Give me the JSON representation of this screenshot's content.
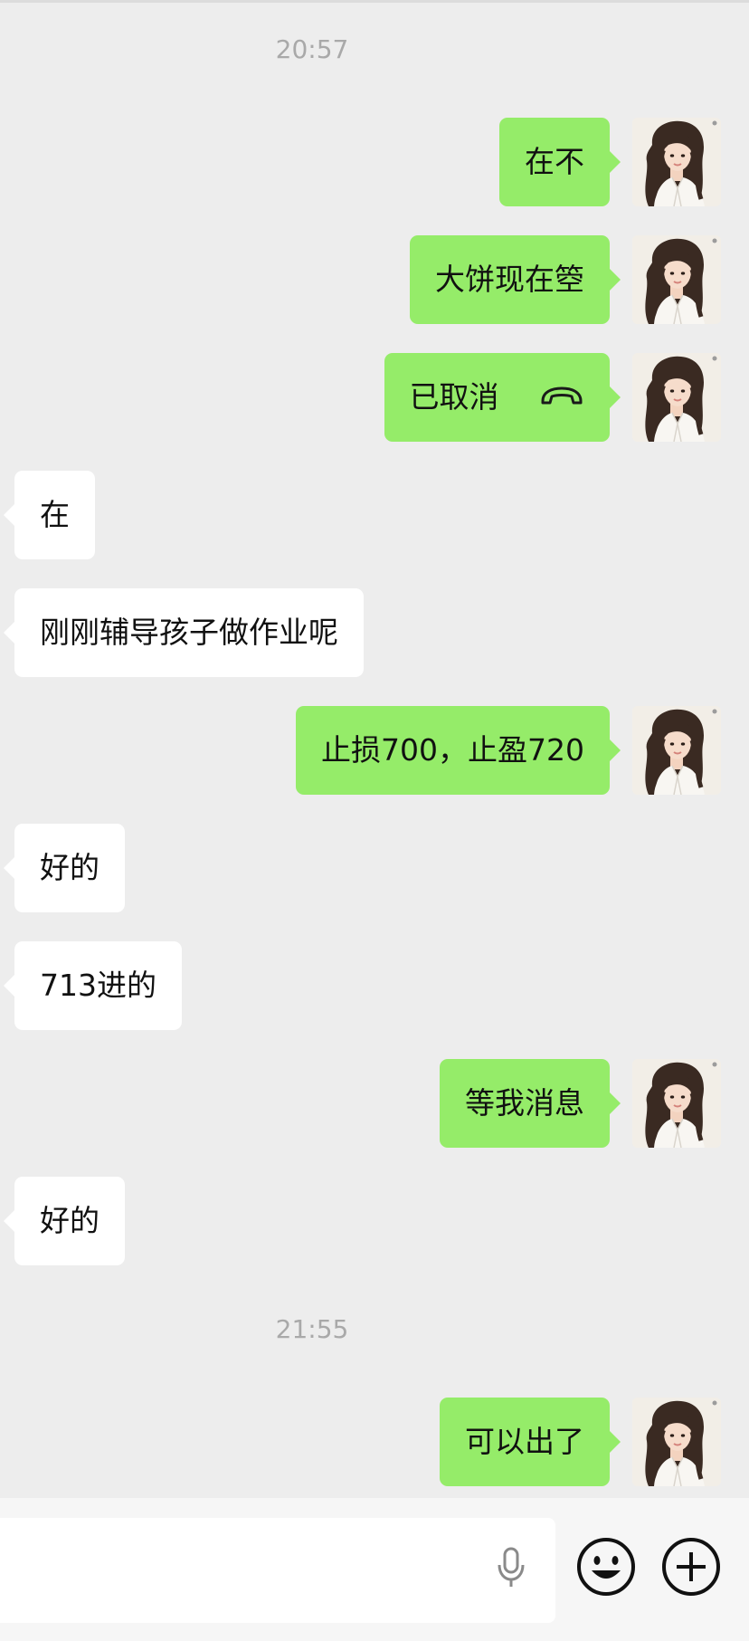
{
  "chat": {
    "timestamps": [
      "20:57",
      "21:55"
    ],
    "messages": [
      {
        "dir": "out",
        "text": "在不"
      },
      {
        "dir": "out",
        "text": "大饼现在箜"
      },
      {
        "dir": "out",
        "text": "已取消",
        "icon": "hangup-phone-icon"
      },
      {
        "dir": "in",
        "text": "在"
      },
      {
        "dir": "in",
        "text": "刚刚辅导孩子做作业呢"
      },
      {
        "dir": "out",
        "text": "止损700，止盈720"
      },
      {
        "dir": "in",
        "text": "好的"
      },
      {
        "dir": "in",
        "text": "713进的"
      },
      {
        "dir": "out",
        "text": "等我消息"
      },
      {
        "dir": "in",
        "text": "好的"
      },
      {
        "dir": "out",
        "text": "可以出了"
      }
    ]
  },
  "input_bar": {
    "input_value": "",
    "icons": [
      "microphone-icon",
      "emoji-icon",
      "plus-icon"
    ]
  },
  "colors": {
    "background": "#ededed",
    "outgoing_bubble": "#95ec69",
    "incoming_bubble": "#ffffff",
    "timestamp": "#a9a9a9"
  }
}
